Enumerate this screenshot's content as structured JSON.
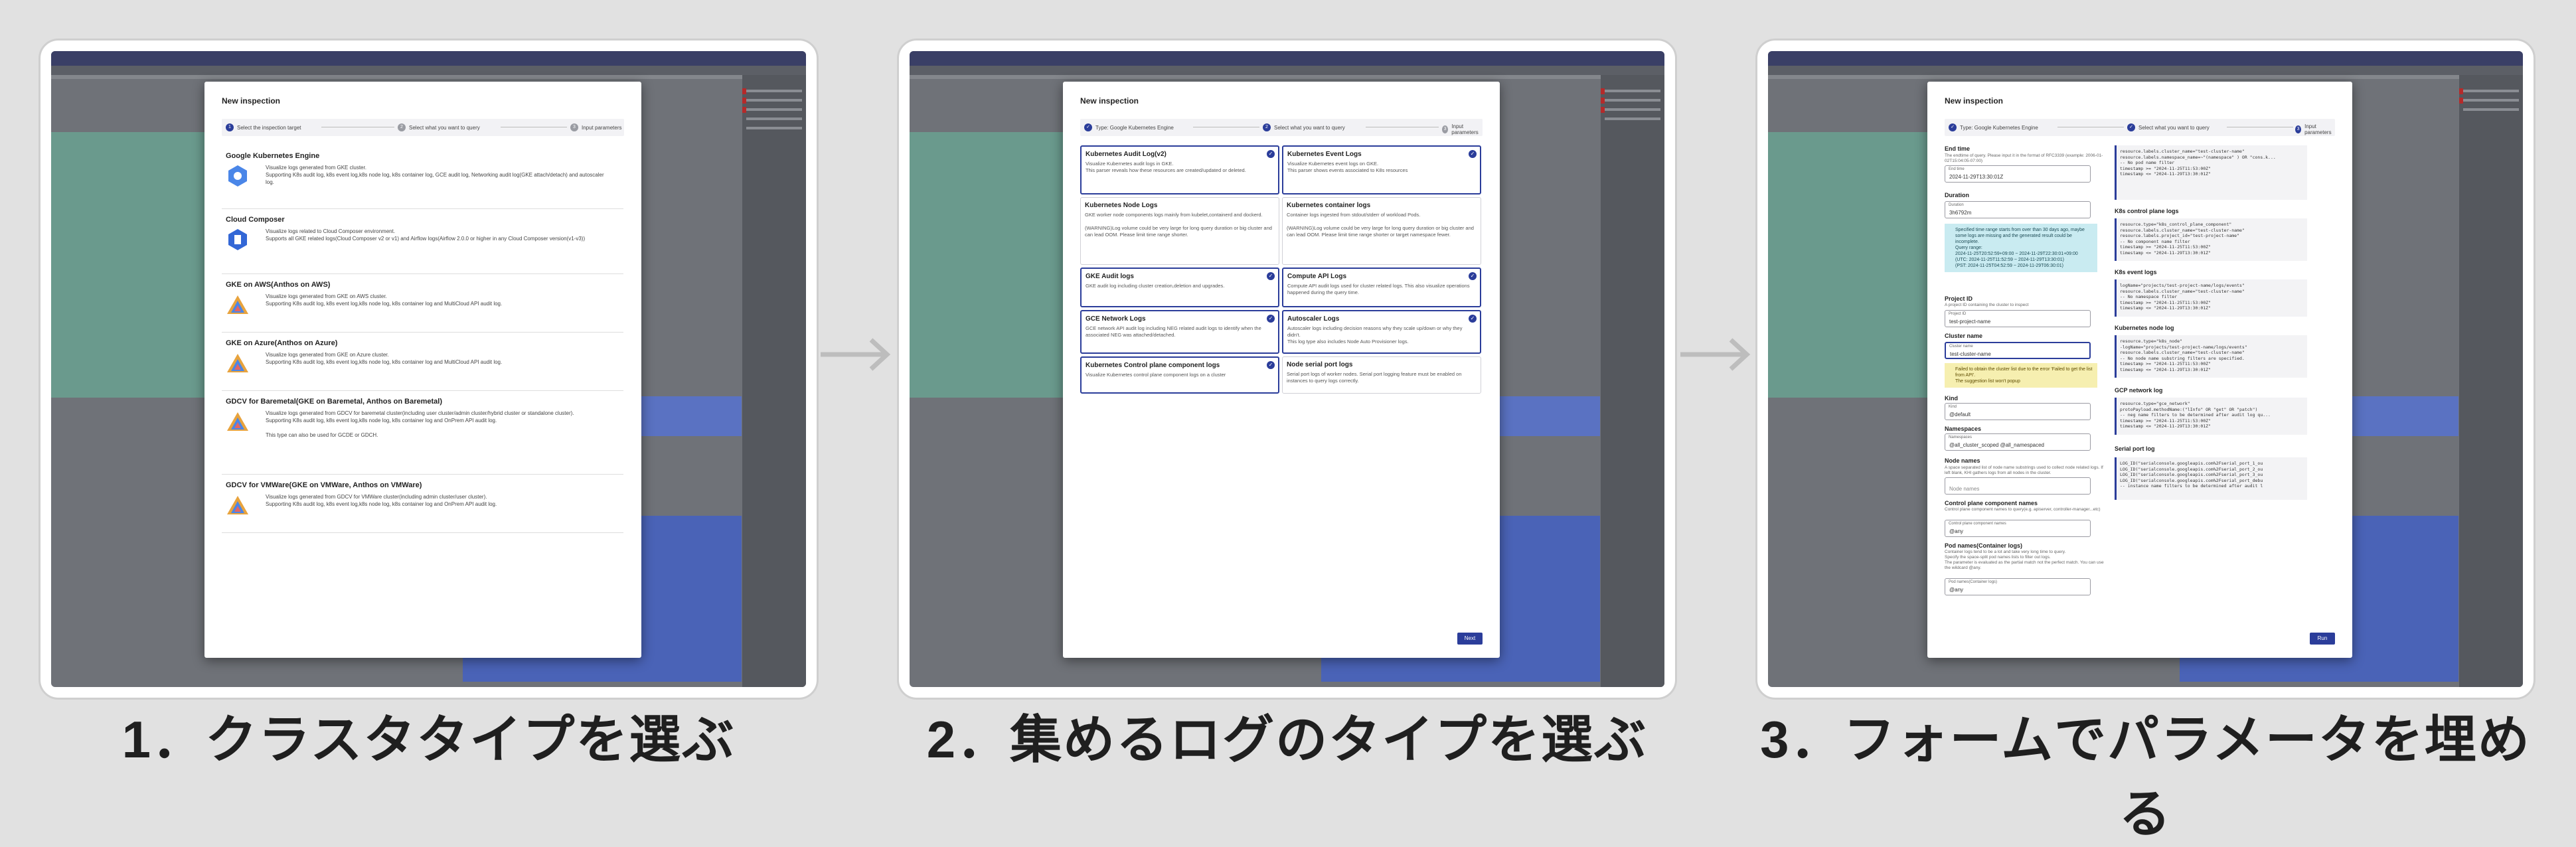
{
  "captions": [
    "1．クラスタタイプを選ぶ",
    "2．集めるログのタイプを選ぶ",
    "3．フォームでパラメータを埋める"
  ],
  "dialog_title": "New inspection",
  "panel1": {
    "steps": [
      "Select the inspection target",
      "Select what you want to query",
      "Input parameters"
    ],
    "clusters": [
      {
        "title": "Google Kubernetes Engine",
        "desc": "Visualize logs generated from GKE cluster.\nSupporting K8s audit log, k8s event log,k8s node log, k8s container log, GCE audit log, Networking audit log(GKE attach/detach) and autoscaler log."
      },
      {
        "title": "Cloud Composer",
        "desc": "Visualize logs related to Cloud Composer environment.\nSupports all GKE related logs(Cloud Composer v2 or v1) and Airflow logs(Airflow 2.0.0 or higher in any Cloud Composer version(v1-v3))"
      },
      {
        "title": "GKE on AWS(Anthos on AWS)",
        "desc": "Visualize logs generated from GKE on AWS cluster.\nSupporting K8s audit log, k8s event log,k8s node log, k8s container log and MultiCloud API audit log."
      },
      {
        "title": "GKE on Azure(Anthos on Azure)",
        "desc": "Visualize logs generated from GKE on Azure cluster.\nSupporting K8s audit log, k8s event log,k8s node log, k8s container log and MultiCloud API audit log."
      },
      {
        "title": "GDCV for Baremetal(GKE on Baremetal, Anthos on Baremetal)",
        "desc": "Visualize logs generated from GDCV for baremetal cluster(including user cluster/admin cluster/hybrid cluster or standalone cluster).\nSupporting K8s audit log, k8s event log,k8s node log, k8s container log and OnPrem API audit log.\n\nThis type can also be used for GCDE or GDCH."
      },
      {
        "title": "GDCV for VMWare(GKE on VMWare, Anthos on VMWare)",
        "desc": "Visualize logs generated from GDCV for VMWare cluster(including admin cluster/user cluster).\nSupporting K8s audit log, k8s event log,k8s node log, k8s container log and OnPrem API audit log."
      }
    ]
  },
  "panel2": {
    "steps": [
      "Type: Google Kubernetes Engine",
      "Select what you want to query",
      "Input parameters"
    ],
    "cards": [
      {
        "title": "Kubernetes Audit Log(v2)",
        "desc": "Visualize Kubernetes audit logs in GKE.\nThis parser reveals how these resources are created/updated or deleted.",
        "sel": true
      },
      {
        "title": "Kubernetes Event Logs",
        "desc": "Visualize Kubernetes event logs on GKE.\nThis parser shows events associated to K8s resources",
        "sel": true
      },
      {
        "title": "Kubernetes Node Logs",
        "desc": "GKE worker node components logs mainly from kubelet,containerd and dockerd.\n\n(WARNING)Log volume could be very large for long query duration or big cluster and can lead OOM. Please limit time range shorter.",
        "sel": false
      },
      {
        "title": "Kubernetes container logs",
        "desc": "Container logs ingested from stdout/stderr of workload Pods.\n\n(WARNING)Log volume could be very large for long query duration or big cluster and can lead OOM. Please limit time range shorter or target namespace fewer.",
        "sel": false
      },
      {
        "title": "GKE Audit logs",
        "desc": "GKE audit log including cluster creation,deletion and upgrades.",
        "sel": true
      },
      {
        "title": "Compute API Logs",
        "desc": "Compute API audit logs used for cluster related logs. This also visualize operations happened during the query time.",
        "sel": true
      },
      {
        "title": "GCE Network Logs",
        "desc": "GCE network API audit log including NEG related audit logs to identify when the associated NEG was attached/detached.",
        "sel": true
      },
      {
        "title": "Autoscaler Logs",
        "desc": "Autoscaler logs including decision reasons why they scale up/down or why they didn't.\nThis log type also includes Node Auto Provisioner logs.",
        "sel": true
      },
      {
        "title": "Kubernetes Control plane component logs",
        "desc": "Visualize Kubernetes control plane component logs on a cluster",
        "sel": true
      },
      {
        "title": "Node serial port logs",
        "desc": "Serial port logs of worker nodes. Serial port logging feature must be enabled on instances to query logs correctly.",
        "sel": false
      }
    ],
    "next": "Next"
  },
  "panel3": {
    "steps": [
      "Type: Google Kubernetes Engine",
      "Select what you want to query",
      "Input parameters"
    ],
    "end_time": {
      "label": "End time",
      "sub": "The endtime of query. Please input it in the format of RFC3339 (example: 2006-01-02T15:04:05-07:00)",
      "value": "2024-11-29T13:30:01Z",
      "tag": "End time"
    },
    "duration": {
      "label": "Duration",
      "value": "3h6792m",
      "tag": "Duration"
    },
    "info": "Specified time range starts from over than 30 days ago, maybe some logs are missing and the generated result could be incomplete.\nQuery range:\n2024-11-25T20:52:59+09:00 ~ 2024-11-29T22:30:01+09:00\n(UTC: 2024-11-25T11:52:59 ~ 2024-11-29T13:30:01)\n(PST: 2024-11-25T04:52:59 ~ 2024-11-29T06:30:01)",
    "project": {
      "label": "Project ID",
      "sub": "A project ID containing the cluster to inspect",
      "value": "test-project-name",
      "tag": "Project ID"
    },
    "cluster": {
      "label": "Cluster name",
      "value": "test-cluster-name",
      "tag": "Cluster name"
    },
    "warn": "Failed to obtain the cluster list due to the error 'Failed to get the list from API'.\nThe suggestion list won't popup",
    "kind": {
      "label": "Kind",
      "value": "@default",
      "tag": "Kind"
    },
    "namespaces": {
      "label": "Namespaces",
      "value": "@all_cluster_scoped @all_namespaced",
      "tag": "Namespaces"
    },
    "node_names": {
      "label": "Node names",
      "sub": "A space separated list of node name substrings used to collect node related logs. If left blank, KHI gathers logs from all nodes in the cluster.",
      "placeholder": "Node names"
    },
    "cp": {
      "label": "Control plane component names",
      "sub": "Control plane component names to query(e.g. apiserver, controller-manager...etc)",
      "value": "@any",
      "tag": "Control plane component names"
    },
    "pod": {
      "label": "Pod names(Container logs)",
      "sub": "Container logs tend to be a lot and take very long time to query.\nSpecify the space-split pod names lists to filter out logs.\nThe parameter is evaluated as the partial match not the perfect match. You can use the wildcard @any.",
      "value": "@any",
      "tag": "Pod names(Container logs)"
    },
    "sections": [
      {
        "title": "",
        "code": [
          "resource.labels.cluster_name=\"test-cluster-name\"",
          "resource.labels.namespace_name=~\"(namespace\"\n) OR \"cons.k...",
          "-- No pod name filter",
          "timestamp >= \"2024-11-25T11:53:00Z\"",
          "timestamp <= \"2024-11-29T13:30:01Z\""
        ]
      },
      {
        "title": "K8s control plane logs",
        "code": [
          "resource.type=\"k8s_control_plane_component\"",
          "resource.labels.cluster_name=\"test-cluster-name\"",
          "resource.labels.project_id=\"test-project-name\"",
          "-- No component name filter",
          "timestamp >= \"2024-11-25T11:53:00Z\"",
          "timestamp <= \"2024-11-29T13:30:01Z\""
        ]
      },
      {
        "title": "K8s event logs",
        "code": [
          "logName=\"projects/test-project-name/logs/events\"",
          "resource.labels.cluster_name=\"test-cluster-name\"",
          "-- No namespace filter",
          "timestamp >= \"2024-11-25T11:53:00Z\"",
          "timestamp <= \"2024-11-29T13:30:01Z\""
        ]
      },
      {
        "title": "Kubernetes node log",
        "code": [
          "resource.type=\"k8s_node\"",
          "-logName=\"projects/test-project-name/logs/events\"",
          "resource.labels.cluster_name=\"test-cluster-name\"",
          "-- No node name substring filters are specified.",
          "timestamp >= \"2024-11-25T11:53:00Z\"",
          "timestamp <= \"2024-11-29T13:30:01Z\""
        ]
      },
      {
        "title": "GCP network log",
        "code": [
          "resource.type=\"gce_network\"",
          "protoPayload.methodName:(\"lInfo\" OR \"get\" OR \"patch\")",
          "-- neg name filters to be determined after audit log qu...",
          "timestamp >= \"2024-11-25T11:53:00Z\"",
          "timestamp <= \"2024-11-29T13:30:01Z\""
        ]
      },
      {
        "title": "Serial port log",
        "code": [
          "LOG_ID(\"serialconsole.googleapis.com%2Fserial_port_1_ou",
          "LOG_ID(\"serialconsole.googleapis.com%2Fserial_port_2_ou",
          "LOG_ID(\"serialconsole.googleapis.com%2Fserial_port_3_ou",
          "LOG_ID(\"serialconsole.googleapis.com%2Fserial_port_debu",
          "",
          "-- instance name filters to be determined after audit l"
        ]
      }
    ],
    "run": "Run"
  }
}
